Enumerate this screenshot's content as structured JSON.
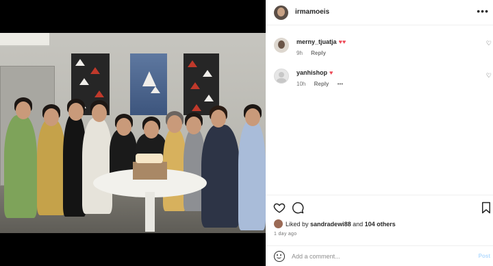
{
  "post": {
    "author": "irmamoeis",
    "more_icon": "more-horizontal-icon",
    "more_label": "•••"
  },
  "comments": [
    {
      "user": "merny_tjuatja",
      "hearts": "♥♥",
      "time": "9h",
      "reply": "Reply",
      "options": ""
    },
    {
      "user": "yanhishop",
      "hearts": "♥",
      "time": "10h",
      "reply": "Reply",
      "options": "•••"
    }
  ],
  "actions": {
    "like_icon": "heart-outline-icon",
    "comment_icon": "comment-icon",
    "save_icon": "bookmark-icon"
  },
  "likes": {
    "prefix": "Liked by",
    "user": "sandradewi88",
    "conj": "and",
    "others": "104 others"
  },
  "posted_ago": "1 day ago",
  "add_comment": {
    "placeholder": "Add a comment...",
    "post_label": "Post",
    "emoji_icon": "emoji-icon"
  },
  "colors": {
    "heart": "#ed4956",
    "muted": "#737373",
    "post_disabled": "#b3dbff"
  }
}
